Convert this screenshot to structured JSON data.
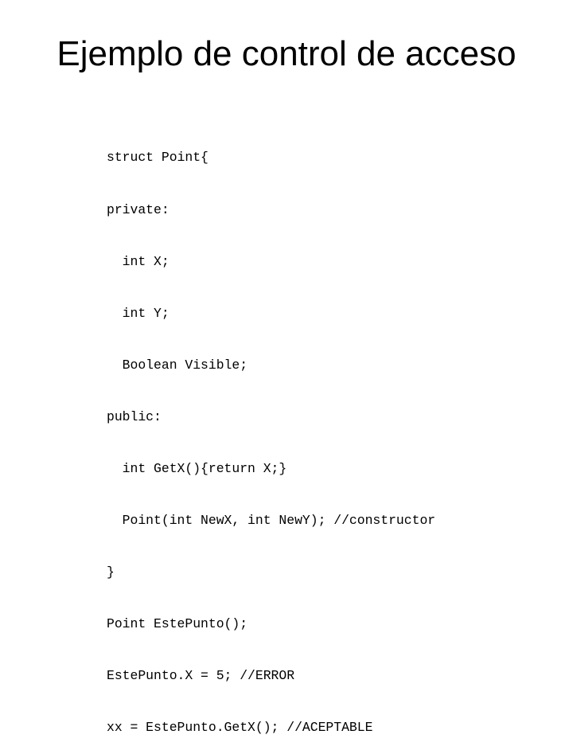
{
  "slide": {
    "title": "Ejemplo de control de acceso",
    "code_lines": [
      "struct Point{",
      "private:",
      "  int X;",
      "  int Y;",
      "  Boolean Visible;",
      "public:",
      "  int GetX(){return X;}",
      "  Point(int NewX, int NewY); //constructor",
      "}",
      "Point EstePunto();",
      "EstePunto.X = 5; //ERROR",
      "xx = EstePunto.GetX(); //ACEPTABLE"
    ]
  }
}
